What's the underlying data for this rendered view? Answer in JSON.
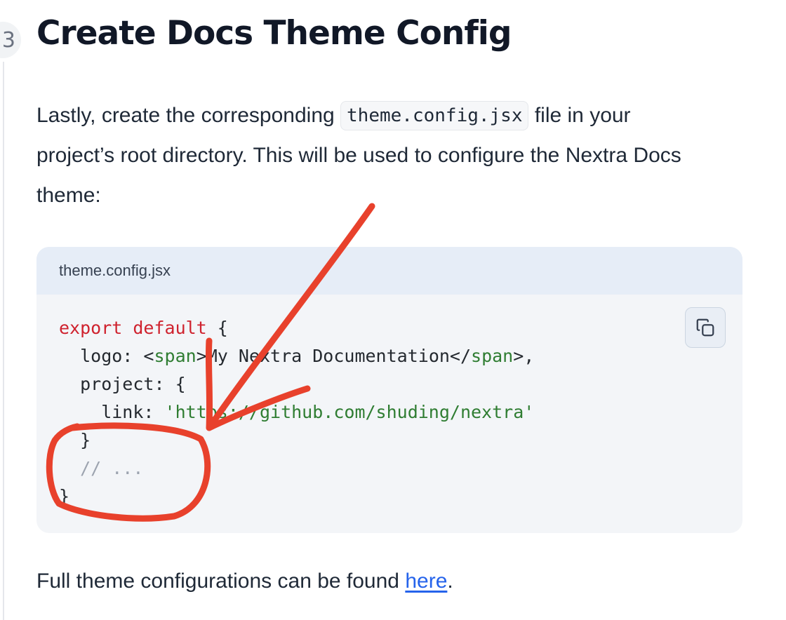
{
  "step": {
    "number": "3",
    "title": "Create Docs Theme Config"
  },
  "intro": {
    "before": "Lastly, create the corresponding ",
    "code": "theme.config.jsx",
    "after": " file in your project’s root directory. This will be used to configure the Nextra Docs theme:"
  },
  "code_block": {
    "filename": "theme.config.jsx",
    "copy_icon": "copy-icon",
    "lines": {
      "l1_kw": "export default",
      "l1_rest": " {",
      "l2_a": "  logo: <",
      "l2_tag1": "span",
      "l2_text": ">My Nextra Documentation</",
      "l2_tag2": "span",
      "l2_end": ">,",
      "l3": "  project: {",
      "l4_key": "    link: ",
      "l4_str": "'https://github.com/shuding/nextra'",
      "l5": "  }",
      "l6": "  // ...",
      "l7": "}"
    }
  },
  "footer": {
    "before": "Full theme configurations can be found ",
    "link": "here",
    "after": "."
  },
  "colors": {
    "annotation": "#e8412c",
    "link": "#2563eb"
  }
}
